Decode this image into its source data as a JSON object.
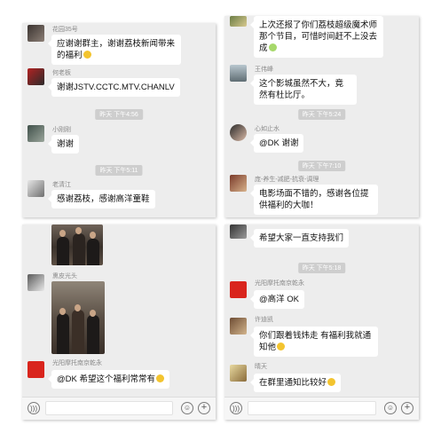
{
  "panel1": {
    "messages": [
      {
        "name": "花园35号",
        "text": "应谢谢群主，谢谢荔枝新闻带来的福利"
      },
      {
        "name": "何老板",
        "text": "谢谢JSTV.CCTC.MTV.CHANLV"
      },
      {
        "time": "昨天 下午4:56"
      },
      {
        "name": "小刚刚",
        "text": "谢谢"
      },
      {
        "time": "昨天 下午5:11"
      },
      {
        "name": "老清江",
        "text": "感谢荔枝，感谢高洋童鞋"
      }
    ]
  },
  "panel2": {
    "messages": [
      {
        "text": "上次还报了你们荔枝超级魔术师那个节目，可惜时间赶不上没去成"
      },
      {
        "name": "王伟峰",
        "text": "这个影城虽然不大，竟然有杜比厅。"
      },
      {
        "time": "昨天 下午5:24"
      },
      {
        "name": "心如止水",
        "text": "@DK 谢谢"
      },
      {
        "time": "昨天 下午7:10"
      },
      {
        "name": "庞-养生-减肥-抗衰-调理",
        "text": "电影场面不错的，感谢各位提供福利的大咖！"
      }
    ]
  },
  "panel3": {
    "messages": [
      {
        "name": "熏皮光头"
      },
      {
        "name": "光阳摩托南京乾永",
        "text": "@DK 希望这个福利常常有"
      }
    ]
  },
  "panel4": {
    "messages": [
      {
        "text": "希望大家一直支持我们"
      },
      {
        "time": "昨天 下午5:18"
      },
      {
        "name": "光阳摩托南京乾永",
        "text": "@高洋 OK"
      },
      {
        "name": "许迪凯",
        "text": "你们跟着钱炜走 有福利我就通知他"
      },
      {
        "name": "晴天",
        "text": "在群里通知比较好"
      }
    ]
  },
  "input_bar": {
    "voice_icon": "voice-icon",
    "emoji_icon": "emoji-icon",
    "plus_icon": "plus-icon"
  },
  "colors": {
    "chat_bg": "#ededed",
    "bubble": "#ffffff",
    "time_badge": "#cecece"
  }
}
